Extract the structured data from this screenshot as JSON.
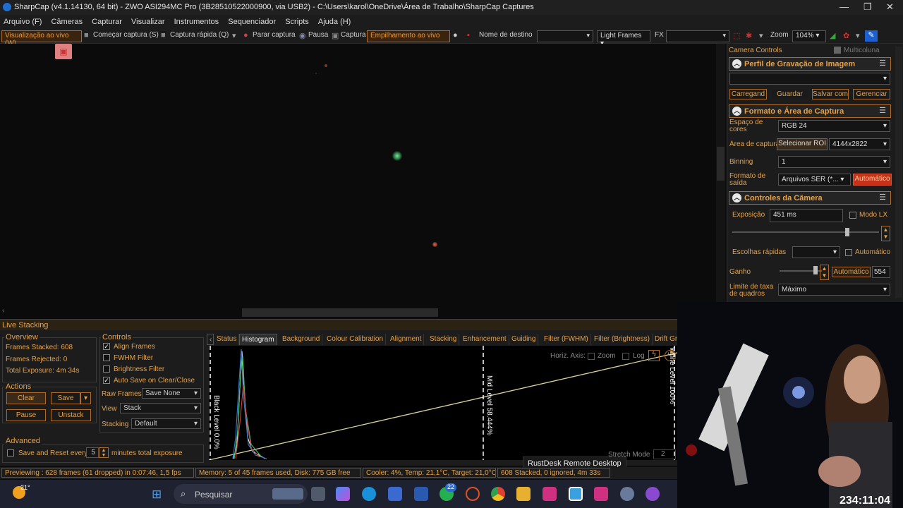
{
  "title": "SharpCap (v4.1.14130, 64 bit) - ZWO ASI294MC Pro (3B28510522000900, via USB2) - C:\\Users\\karol\\OneDrive\\Área de Trabalho\\SharpCap Captures",
  "menu": [
    "Arquivo (F)",
    "Câmeras",
    "Capturar",
    "Visualizar",
    "Instrumentos",
    "Sequenciador",
    "Scripts",
    "Ajuda (H)"
  ],
  "toolbar": {
    "live_view": "Visualização ao vivo (W)",
    "start_capture": "Começar captura (S)",
    "quick_capture": "Captura rápida (Q)",
    "stop_capture": "Parar captura",
    "pause": "Pausa",
    "capture": "Captura",
    "live_stack": "Empilhamento ao vivo",
    "target_label": "Nome de destino",
    "frame_type": "Light Frames",
    "fx": "FX",
    "zoom_label": "Zoom",
    "zoom_value": "104%"
  },
  "right_panel": {
    "header": "Camera Controls",
    "multicolumn": "Multicoluna",
    "profile": {
      "title": "Perfil de Gravação de Imagem",
      "buttons": [
        "Carregand",
        "Guardar",
        "Salvar com",
        "Gerenciar"
      ]
    },
    "format": {
      "title": "Formato e Área de Captura",
      "color_space_label": "Espaço de cores",
      "color_space": "RGB 24",
      "area_label": "Área de captura",
      "select_roi": "Selecionar ROI",
      "resolution": "4144x2822",
      "binning_label": "Binning",
      "binning": "1",
      "output_label": "Formato de saída",
      "output": "Arquivos SER (*...",
      "auto": "Automático"
    },
    "camera": {
      "title": "Controles da Câmera",
      "exposure_label": "Exposição",
      "exposure": "451 ms",
      "lx_mode": "Modo LX",
      "quick_label": "Escolhas rápidas",
      "auto_label": "Automático",
      "gain_label": "Ganho",
      "gain_auto": "Automático",
      "gain": "554",
      "frame_rate_label": "Limite de taxa de quadros",
      "frame_rate": "Máximo"
    }
  },
  "live_stacking": {
    "title": "Live Stacking",
    "overview_title": "Overview",
    "frames_stacked": "Frames Stacked:  608",
    "frames_rejected": "Frames Rejected:  0",
    "total_exposure": "Total Exposure:     4m 34s",
    "actions_title": "Actions",
    "clear": "Clear",
    "save": "Save",
    "pause": "Pause",
    "unstack": "Unstack",
    "advanced_title": "Advanced",
    "save_reset": "Save and Reset every",
    "minutes_value": "5",
    "minutes_label": "minutes total exposure",
    "controls_title": "Controls",
    "align_frames": "Align Frames",
    "fwhm_filter": "FWHM Filter",
    "brightness_filter": "Brightness Filter",
    "auto_save": "Auto Save on Clear/Close",
    "raw_frames_label": "Raw Frames",
    "raw_frames": "Save None",
    "view_label": "View",
    "view": "Stack",
    "stacking_label": "Stacking",
    "stacking": "Default",
    "tabs": [
      "Status",
      "Histogram",
      "Background",
      "Colour Calibration",
      "Alignment",
      "Stacking",
      "Enhancement",
      "Guiding",
      "Filter (FWHM)",
      "Filter (Brightness)",
      "Drift Gr"
    ],
    "horiz_axis": "Horiz. Axis:",
    "zoom": "Zoom",
    "log": "Log",
    "black_level": "Black Level 0.0%",
    "mid_level": "Mid Level 58.444%",
    "white_level": "White Level 100%",
    "stretch_mode": "Stretch Mode",
    "stretch_value": "2"
  },
  "status_bar": {
    "preview": "Previewing : 628 frames (61 dropped) in 0:07:46, 1,5 fps",
    "memory": "Memory: 5 of 45 frames used, Disk: 775 GB free",
    "cooler": "Cooler: 4%, Temp: 21,1°C, Target: 21,0°C",
    "stacked": "608 Stacked, 0 ignored, 4m 33s"
  },
  "tooltip": "RustDesk Remote Desktop",
  "taskbar": {
    "weather": "21°",
    "search": "Pesquisar",
    "badge": "22"
  },
  "stream_timer": "234:11:04",
  "colors": {
    "accent": "#e6a24a",
    "border_accent": "#b06a28",
    "background": "#1c1c1c"
  }
}
